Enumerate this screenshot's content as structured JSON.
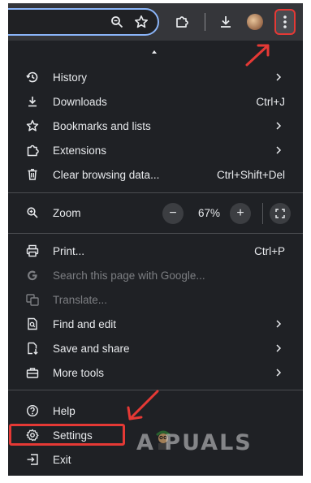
{
  "colors": {
    "menu_bg": "#1f2125",
    "text": "#e8eaed",
    "disabled_text": "#7c7e82",
    "highlight_red": "#e53935",
    "focus_blue": "#8ab4f8"
  },
  "toolbar": {
    "icons": [
      "zoom-icon",
      "bookmark-star-icon",
      "extensions-puzzle-icon",
      "download-icon",
      "profile-avatar",
      "more-options-kebab-icon"
    ]
  },
  "menu": {
    "history": {
      "label": "History"
    },
    "downloads": {
      "label": "Downloads",
      "shortcut": "Ctrl+J"
    },
    "bookmarks": {
      "label": "Bookmarks and lists"
    },
    "extensions": {
      "label": "Extensions"
    },
    "clear": {
      "label": "Clear browsing data...",
      "shortcut": "Ctrl+Shift+Del"
    },
    "zoom": {
      "label": "Zoom",
      "value": "67%",
      "minus": "−",
      "plus": "+"
    },
    "print": {
      "label": "Print...",
      "shortcut": "Ctrl+P"
    },
    "search_google": {
      "label": "Search this page with Google..."
    },
    "translate": {
      "label": "Translate..."
    },
    "find_edit": {
      "label": "Find and edit"
    },
    "save_share": {
      "label": "Save and share"
    },
    "more_tools": {
      "label": "More tools"
    },
    "help": {
      "label": "Help"
    },
    "settings": {
      "label": "Settings"
    },
    "exit": {
      "label": "Exit"
    }
  },
  "watermark": {
    "text": "A PUALS"
  }
}
